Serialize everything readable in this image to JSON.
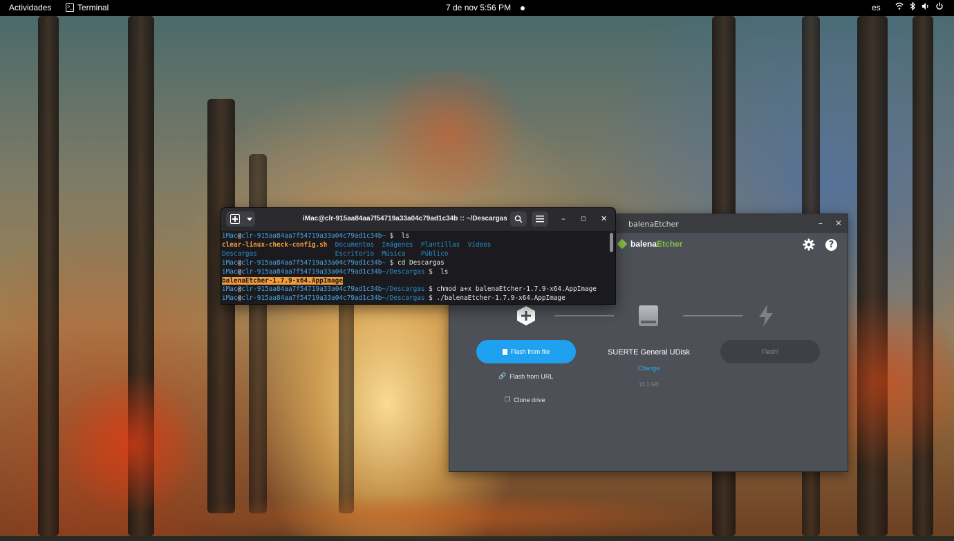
{
  "topbar": {
    "activities": "Actividades",
    "app_name": "Terminal",
    "clock": "7 de nov  5:56 PM",
    "language": "es",
    "tray_icons": [
      "wifi-icon",
      "bluetooth-icon",
      "volume-icon",
      "power-icon"
    ]
  },
  "etcher": {
    "window_title": "balenaEtcher",
    "brand_part1": "balena",
    "brand_part2": "Etcher",
    "flash_from_file": "Flash from file",
    "flash_from_url": "Flash from URL",
    "clone_drive": "Clone drive",
    "drive_name": "SUERTE General UDisk",
    "drive_change": "Change",
    "drive_size": "16.1 GB",
    "flash_button": "Flash!",
    "colors": {
      "accent": "#1fa1f0",
      "brand_green": "#85c043"
    }
  },
  "terminal": {
    "title": "iMac@clr-915aa84aa7f54719a33a04c79ad1c34b :: ~/Descargas",
    "lines": [
      {
        "user": "iMac",
        "at": "@",
        "host": "clr-915aa84aa7f54719a33a04c79ad1c34b",
        "path": "~",
        "prompt": " $  ls"
      },
      {
        "ls1": "clear-linux-check-config.sh",
        "ls2": "  Documentos  Imágenes  Plantillas  Vídeos"
      },
      {
        "ls3": "Descargas                    Escritorio  Música    Público"
      },
      {
        "user": "iMac",
        "at": "@",
        "host": "clr-915aa84aa7f54719a33a04c79ad1c34b",
        "path": "~",
        "prompt": " $ cd Descargas"
      },
      {
        "user": "iMac",
        "at": "@",
        "host": "clr-915aa84aa7f54719a33a04c79ad1c34b",
        "path": "~/Descargas",
        "prompt": " $  ls"
      },
      {
        "file": "balenaEtcher-1.7.9-x64.AppImage"
      },
      {
        "user": "iMac",
        "at": "@",
        "host": "clr-915aa84aa7f54719a33a04c79ad1c34b",
        "path": "~/Descargas",
        "prompt": " $ chmod a+x balenaEtcher-1.7.9-x64.AppImage"
      },
      {
        "user": "iMac",
        "at": "@",
        "host": "clr-915aa84aa7f54719a33a04c79ad1c34b",
        "path": "~/Descargas",
        "prompt": " $ ./balenaEtcher-1.7.9-x64.AppImage"
      }
    ]
  }
}
